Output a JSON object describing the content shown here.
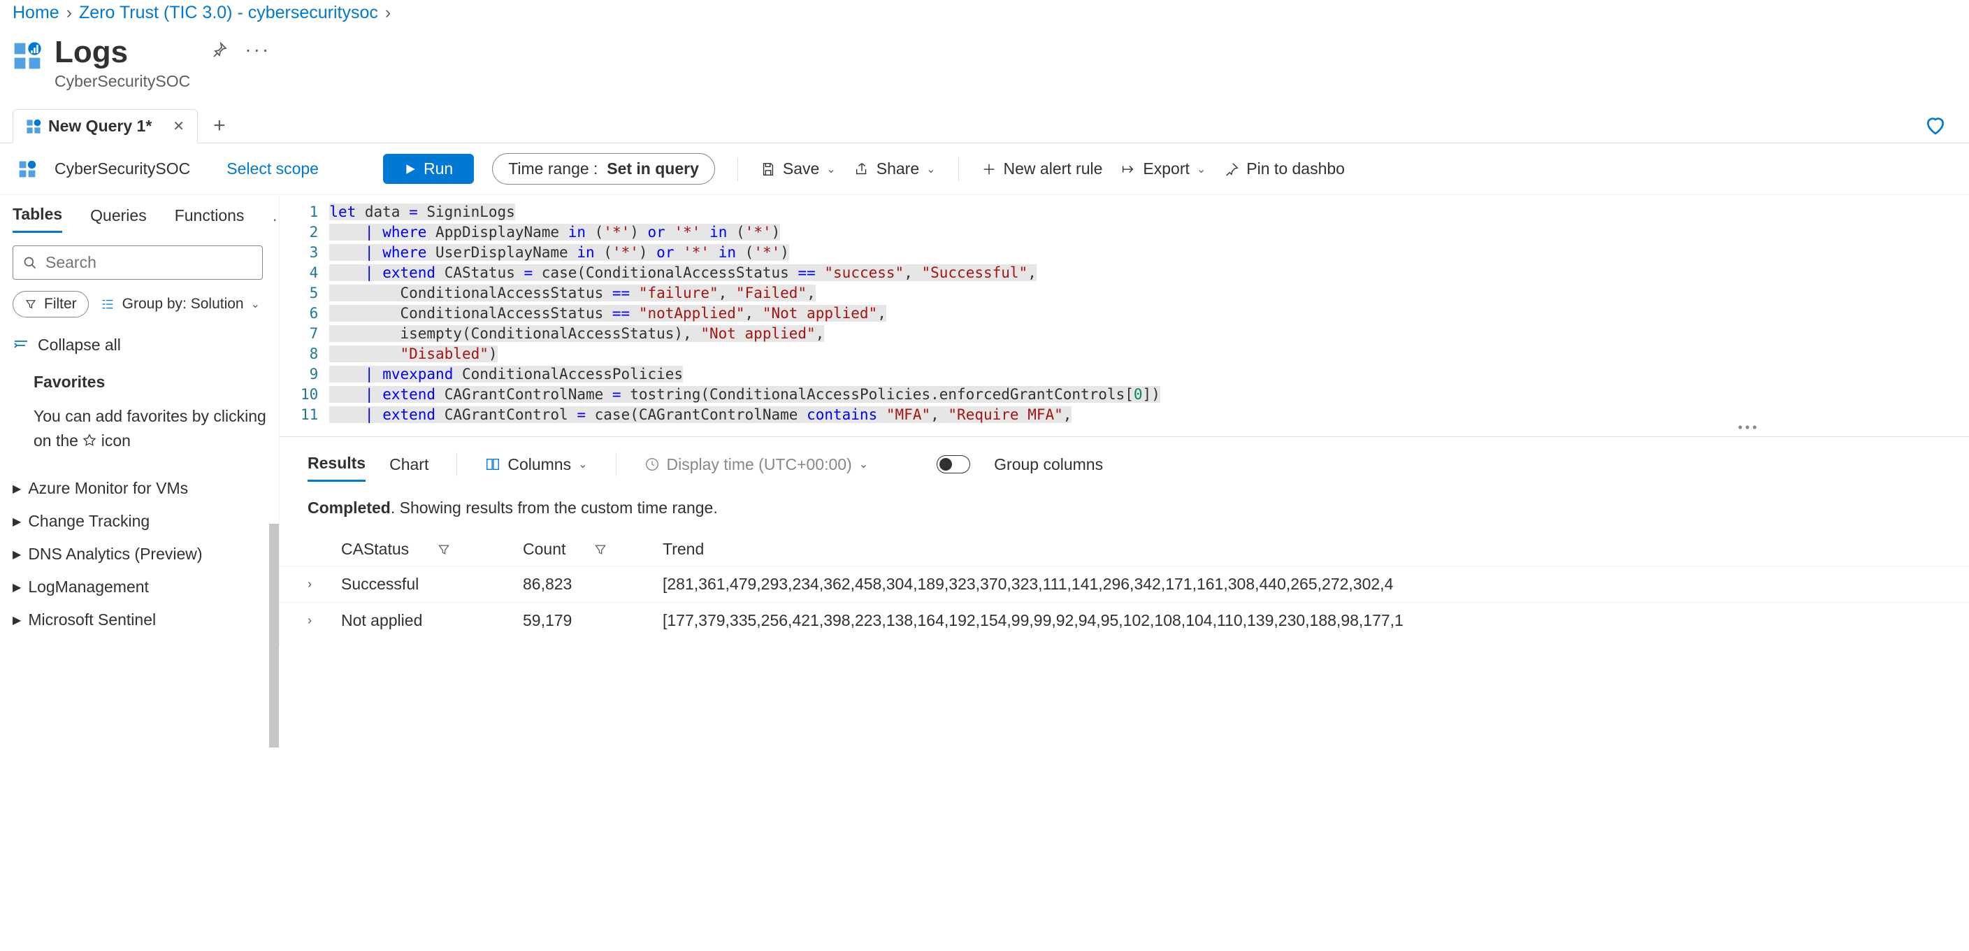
{
  "breadcrumbs": {
    "home": "Home",
    "mid": "Zero Trust (TIC 3.0) - cybersecuritysoc"
  },
  "header": {
    "title": "Logs",
    "subtitle": "CyberSecuritySOC"
  },
  "query_tabs": {
    "active": "New Query 1*"
  },
  "toolbar": {
    "scope": "CyberSecuritySOC",
    "select_scope": "Select scope",
    "run": "Run",
    "time_range_label": "Time range :",
    "time_range_value": "Set in query",
    "save": "Save",
    "share": "Share",
    "new_alert": "New alert rule",
    "export": "Export",
    "pin": "Pin to dashbo"
  },
  "left_panel": {
    "tabs": {
      "tables": "Tables",
      "queries": "Queries",
      "functions": "Functions"
    },
    "search_placeholder": "Search",
    "filter": "Filter",
    "group_by": "Group by: Solution",
    "collapse_all": "Collapse all",
    "favorites_title": "Favorites",
    "favorites_text_a": "You can add favorites by clicking on the ",
    "favorites_text_b": " icon",
    "tree": [
      "Azure Monitor for VMs",
      "Change Tracking",
      "DNS Analytics (Preview)",
      "LogManagement",
      "Microsoft Sentinel"
    ]
  },
  "editor": {
    "tokens": [
      [
        [
          "kw",
          "let"
        ],
        [
          "pl",
          " data "
        ],
        [
          "op",
          "="
        ],
        [
          "pl",
          " SigninLogs"
        ]
      ],
      [
        [
          "pl",
          "    "
        ],
        [
          "op",
          "|"
        ],
        [
          "pl",
          " "
        ],
        [
          "kw",
          "where"
        ],
        [
          "pl",
          " AppDisplayName "
        ],
        [
          "kw",
          "in"
        ],
        [
          "pl",
          " ("
        ],
        [
          "str",
          "'*'"
        ],
        [
          "pl",
          ") "
        ],
        [
          "kw",
          "or"
        ],
        [
          "pl",
          " "
        ],
        [
          "str",
          "'*'"
        ],
        [
          "pl",
          " "
        ],
        [
          "kw",
          "in"
        ],
        [
          "pl",
          " ("
        ],
        [
          "str",
          "'*'"
        ],
        [
          "pl",
          ")"
        ]
      ],
      [
        [
          "pl",
          "    "
        ],
        [
          "op",
          "|"
        ],
        [
          "pl",
          " "
        ],
        [
          "kw",
          "where"
        ],
        [
          "pl",
          " UserDisplayName "
        ],
        [
          "kw",
          "in"
        ],
        [
          "pl",
          " ("
        ],
        [
          "str",
          "'*'"
        ],
        [
          "pl",
          ") "
        ],
        [
          "kw",
          "or"
        ],
        [
          "pl",
          " "
        ],
        [
          "str",
          "'*'"
        ],
        [
          "pl",
          " "
        ],
        [
          "kw",
          "in"
        ],
        [
          "pl",
          " ("
        ],
        [
          "str",
          "'*'"
        ],
        [
          "pl",
          ")"
        ]
      ],
      [
        [
          "pl",
          "    "
        ],
        [
          "op",
          "|"
        ],
        [
          "pl",
          " "
        ],
        [
          "kw",
          "extend"
        ],
        [
          "pl",
          " CAStatus "
        ],
        [
          "op",
          "="
        ],
        [
          "pl",
          " case(ConditionalAccessStatus "
        ],
        [
          "op",
          "=="
        ],
        [
          "pl",
          " "
        ],
        [
          "str",
          "\"success\""
        ],
        [
          "pl",
          ", "
        ],
        [
          "str",
          "\"Successful\""
        ],
        [
          "pl",
          ","
        ]
      ],
      [
        [
          "pl",
          "        ConditionalAccessStatus "
        ],
        [
          "op",
          "=="
        ],
        [
          "pl",
          " "
        ],
        [
          "str",
          "\"failure\""
        ],
        [
          "pl",
          ", "
        ],
        [
          "str",
          "\"Failed\""
        ],
        [
          "pl",
          ","
        ]
      ],
      [
        [
          "pl",
          "        ConditionalAccessStatus "
        ],
        [
          "op",
          "=="
        ],
        [
          "pl",
          " "
        ],
        [
          "str",
          "\"notApplied\""
        ],
        [
          "pl",
          ", "
        ],
        [
          "str",
          "\"Not applied\""
        ],
        [
          "pl",
          ","
        ]
      ],
      [
        [
          "pl",
          "        isempty(ConditionalAccessStatus), "
        ],
        [
          "str",
          "\"Not applied\""
        ],
        [
          "pl",
          ","
        ]
      ],
      [
        [
          "pl",
          "        "
        ],
        [
          "str",
          "\"Disabled\""
        ],
        [
          "pl",
          ")"
        ]
      ],
      [
        [
          "pl",
          "    "
        ],
        [
          "op",
          "|"
        ],
        [
          "pl",
          " "
        ],
        [
          "kw",
          "mvexpand"
        ],
        [
          "pl",
          " ConditionalAccessPolicies"
        ]
      ],
      [
        [
          "pl",
          "    "
        ],
        [
          "op",
          "|"
        ],
        [
          "pl",
          " "
        ],
        [
          "kw",
          "extend"
        ],
        [
          "pl",
          " CAGrantControlName "
        ],
        [
          "op",
          "="
        ],
        [
          "pl",
          " tostring(ConditionalAccessPolicies.enforcedGrantControls["
        ],
        [
          "num",
          "0"
        ],
        [
          "pl",
          "])"
        ]
      ],
      [
        [
          "pl",
          "    "
        ],
        [
          "op",
          "|"
        ],
        [
          "pl",
          " "
        ],
        [
          "kw",
          "extend"
        ],
        [
          "pl",
          " CAGrantControl "
        ],
        [
          "op",
          "="
        ],
        [
          "pl",
          " case(CAGrantControlName "
        ],
        [
          "kw",
          "contains"
        ],
        [
          "pl",
          " "
        ],
        [
          "str",
          "\"MFA\""
        ],
        [
          "pl",
          ", "
        ],
        [
          "str",
          "\"Require MFA\""
        ],
        [
          "pl",
          ","
        ]
      ]
    ]
  },
  "results": {
    "tabs": {
      "results": "Results",
      "chart": "Chart"
    },
    "columns_btn": "Columns",
    "display_time": "Display time (UTC+00:00)",
    "group_columns": "Group columns",
    "status_bold": "Completed",
    "status_rest": ". Showing results from the custom time range.",
    "headers": {
      "c1": "CAStatus",
      "c2": "Count",
      "c3": "Trend"
    },
    "rows": [
      {
        "status": "Successful",
        "count": "86,823",
        "trend": "[281,361,479,293,234,362,458,304,189,323,370,323,111,141,296,342,171,161,308,440,265,272,302,4"
      },
      {
        "status": "Not applied",
        "count": "59,179",
        "trend": "[177,379,335,256,421,398,223,138,164,192,154,99,99,92,94,95,102,108,104,110,139,230,188,98,177,1"
      }
    ]
  }
}
